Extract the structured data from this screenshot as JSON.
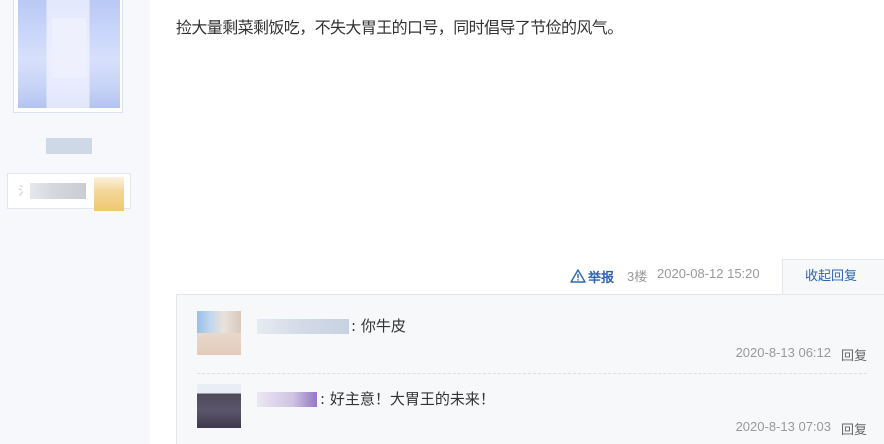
{
  "post": {
    "text": "捡大量剩菜剩饭吃，不失大胃王的口号，同时倡导了节俭的风气。",
    "report_label": "举报",
    "floor": "3楼",
    "time": "2020-08-12 15:20",
    "collapse_label": "收起回复"
  },
  "author": {
    "badge_prefix": "氵"
  },
  "replies": [
    {
      "text": ": 你牛皮",
      "time": "2020-8-13 06:12",
      "reply_label": "回复"
    },
    {
      "text": ": 好主意！大胃王的未来！",
      "time": "2020-8-13 07:03",
      "reply_label": "回复"
    }
  ],
  "colors": {
    "link": "#2d64b3",
    "meta": "#999999",
    "text": "#333333",
    "reply_bg": "#f7f8fa",
    "user_col_bg": "#f6f8fb"
  },
  "icons": {
    "report": "warning-triangle-icon"
  }
}
